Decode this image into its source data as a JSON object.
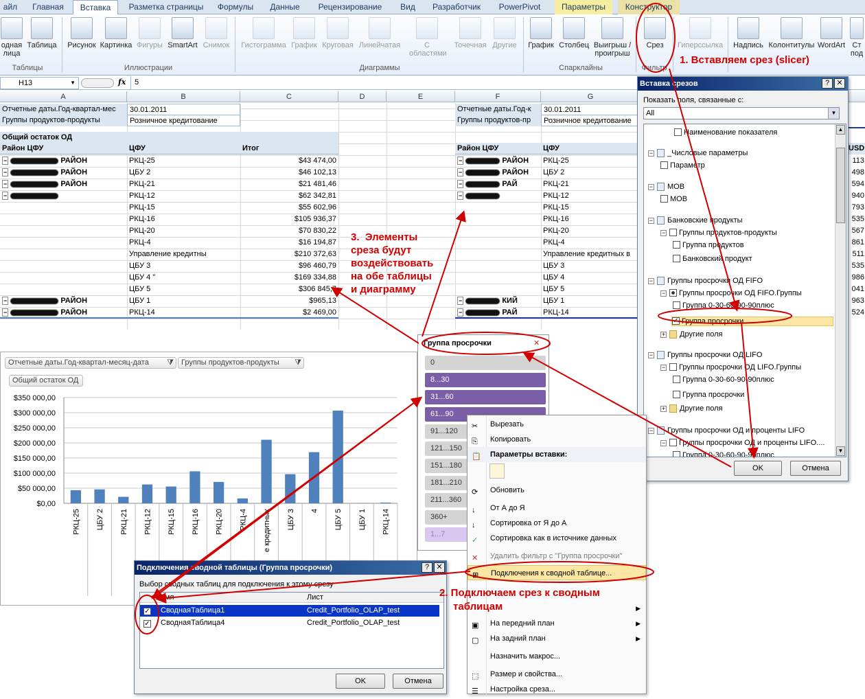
{
  "ribbon": {
    "tabs": [
      "айл",
      "Главная",
      "Вставка",
      "Разметка страницы",
      "Формулы",
      "Данные",
      "Рецензирование",
      "Вид",
      "Разработчик",
      "PowerPivot",
      "Параметры",
      "Конструктор"
    ],
    "buttons": {
      "pivot": "одная\nлица",
      "table": "Таблица",
      "picture": "Рисунок",
      "clipart": "Картинка",
      "shapes": "Фигуры",
      "smartart": "SmartArt",
      "screenshot": "Снимок",
      "hist": "Гистограмма",
      "line": "График",
      "pie": "Круговая",
      "bar": "Линейчатая",
      "area": "С\nобластями",
      "scatter": "Точечная",
      "other": "Другие",
      "sp_line": "График",
      "sp_col": "Столбец",
      "sp_wl": "Выигрыш /\nпроигрыш",
      "slicer": "Срез",
      "hyperlink": "Гиперссылка",
      "textbox": "Надпись",
      "header": "Колонтитулы",
      "wordart": "WordArt",
      "sign": "Ст\nпод"
    },
    "groups": {
      "tables": "Таблицы",
      "illustrations": "Иллюстрации",
      "charts": "Диаграммы",
      "sparklines": "Спарклайны",
      "filter": "Фильтр"
    }
  },
  "formula_bar": {
    "name_box": "H13",
    "fx": "fx",
    "value": "5"
  },
  "columns": [
    "A",
    "B",
    "C",
    "D",
    "E",
    "F",
    "G"
  ],
  "pivot1": {
    "filters": [
      [
        "Отчетные даты.Год-квартал-мес",
        "30.01.2011"
      ],
      [
        "Группы продуктов-продукты",
        "Розничное кредитование"
      ]
    ],
    "measure": "Общий остаток ОД",
    "headers": [
      "Район ЦФУ",
      "ЦФУ",
      "Итог"
    ],
    "rows": [
      [
        "РАЙОН",
        "РКЦ-25",
        "$43 474,00"
      ],
      [
        "РАЙОН",
        "ЦБУ 2",
        "$46 102,13"
      ],
      [
        "РАЙОН",
        "РКЦ-21",
        "$21 481,46"
      ],
      [
        "",
        "РКЦ-12",
        "$62 342,81"
      ],
      [
        "",
        "РКЦ-15",
        "$55 602,96"
      ],
      [
        "",
        "РКЦ-16",
        "$105 936,37"
      ],
      [
        "",
        "РКЦ-20",
        "$70 830,22"
      ],
      [
        "",
        "РКЦ-4",
        "$16 194,87"
      ],
      [
        "",
        "Управление кредитны",
        "$210 372,63"
      ],
      [
        "",
        "ЦБУ 3",
        "$96 460,79"
      ],
      [
        "",
        "ЦБУ 4 \"",
        "$169 334,88"
      ],
      [
        "",
        "ЦБУ 5",
        "$306 845,7"
      ],
      [
        "РАЙОН",
        "ЦБУ 1",
        "$965,13"
      ],
      [
        "РАЙОН",
        "РКЦ-14",
        "$2 469,00"
      ]
    ]
  },
  "pivot2": {
    "filters": [
      [
        "Отчетные даты.Год-к",
        "30.01.2011"
      ],
      [
        "Группы продуктов-пр",
        "Розничное кредитование"
      ]
    ],
    "headers": [
      "Район ЦФУ",
      "ЦФУ"
    ],
    "rows": [
      [
        "РАЙОН",
        "РКЦ-25",
        "113"
      ],
      [
        "РАЙОН",
        "ЦБУ 2",
        "498"
      ],
      [
        "РАЙ",
        "РКЦ-21",
        "594"
      ],
      [
        "",
        "РКЦ-12",
        "940"
      ],
      [
        "",
        "РКЦ-15",
        "793"
      ],
      [
        "",
        "РКЦ-16",
        "535"
      ],
      [
        "",
        "РКЦ-20",
        "567"
      ],
      [
        "",
        "РКЦ-4",
        "861"
      ],
      [
        "",
        "Управление кредитных в",
        "511"
      ],
      [
        "",
        "ЦБУ 3",
        "535"
      ],
      [
        "",
        "ЦБУ 4",
        "986"
      ],
      [
        "",
        "ЦБУ 5",
        "041"
      ],
      [
        "КИЙ",
        "ЦБУ 1",
        "963"
      ],
      [
        "РАЙ",
        "РКЦ-14",
        "524"
      ]
    ],
    "usd": "USD"
  },
  "chart": {
    "filter_buttons": [
      "Отчетные даты.Год-квартал-месяц-дата",
      "Группы продуктов-продукты"
    ],
    "measure_button": "Общий остаток ОД"
  },
  "chart_data": {
    "type": "bar",
    "categories": [
      "РКЦ-25",
      "ЦБУ 2",
      "РКЦ-21",
      "РКЦ-12",
      "РКЦ-15",
      "РКЦ-16",
      "РКЦ-20",
      "РКЦ-4",
      "е кредитных",
      "ЦБУ 3",
      "4",
      "ЦБУ 5",
      "ЦБУ 1",
      "РКЦ-14"
    ],
    "values": [
      43474,
      46102,
      21481,
      62343,
      55603,
      105936,
      70830,
      16195,
      210373,
      96461,
      169335,
      306846,
      965,
      2469
    ],
    "ylim": [
      0,
      350000
    ],
    "yticks": [
      "$350 000,00",
      "$300 000,00",
      "$250 000,00",
      "$200 000,00",
      "$150 000,00",
      "$100 000,00",
      "$50 000,00",
      "$0,00"
    ],
    "title": "",
    "xlabel": "",
    "ylabel": "",
    "color": "#4f81bd"
  },
  "slicer": {
    "title": "Группа просрочки",
    "items": [
      [
        "0",
        "off"
      ],
      [
        "8...30",
        "on"
      ],
      [
        "31...60",
        "on"
      ],
      [
        "61...90",
        "on"
      ],
      [
        "91...120",
        "off"
      ],
      [
        "121...150",
        "off"
      ],
      [
        "151...180",
        "off"
      ],
      [
        "181...210",
        "off"
      ],
      [
        "211...360",
        "off"
      ],
      [
        "360+",
        "off"
      ],
      [
        "1...7",
        "ghost"
      ]
    ]
  },
  "insert_slicers": {
    "title": "Вставка срезов",
    "show_label": "Показать поля, связанные с:",
    "show_value": "All",
    "tree": [
      [
        0,
        "",
        "cb",
        "Наименование показателя"
      ],
      [
        0,
        "−",
        "tb",
        "_Числовые параметры"
      ],
      [
        1,
        "",
        "cb",
        "Параметр"
      ],
      [
        0,
        "−",
        "tb",
        "МОВ"
      ],
      [
        1,
        "",
        "cb",
        "МОВ"
      ],
      [
        0,
        "−",
        "tb",
        "Банковские продукты"
      ],
      [
        1,
        "−",
        "cb",
        "Группы продуктов-продукты"
      ],
      [
        2,
        "",
        "cb",
        "Группа продуктов"
      ],
      [
        2,
        "",
        "cb",
        "Банковский продукт"
      ],
      [
        0,
        "−",
        "tb",
        "Группы просрочки ОД FIFO"
      ],
      [
        1,
        "−",
        "cbp",
        "Группы просрочки ОД FIFO.Группы"
      ],
      [
        2,
        "",
        "cb",
        "Группа 0-30-60-90-90плюс"
      ],
      [
        2,
        "",
        "cbx",
        "Группа просрочки"
      ],
      [
        1,
        "+",
        "fd",
        "Другие поля"
      ],
      [
        0,
        "−",
        "tb",
        "Группы просрочки ОД LIFO"
      ],
      [
        1,
        "−",
        "cb",
        "Группы просрочки ОД LIFO.Группы"
      ],
      [
        2,
        "",
        "cb",
        "Группа 0-30-60-90-90плюс"
      ],
      [
        2,
        "",
        "cb",
        "Группа просрочки"
      ],
      [
        1,
        "+",
        "fd",
        "Другие поля"
      ],
      [
        0,
        "−",
        "tb",
        "Группы просрочки ОД и проценты LIFO"
      ],
      [
        1,
        "−",
        "cb",
        "Группы просрочки ОД и проценты LIFO...."
      ],
      [
        2,
        "",
        "cb",
        "Группа 0-30-60-90-90плюс"
      ]
    ],
    "ok": "OK",
    "cancel": "Отмена"
  },
  "context_menu": {
    "items": [
      "Вырезать",
      "Копировать",
      "Параметры вставки:",
      "Обновить",
      "От А до Я",
      "Сортировка от Я до А",
      "Сортировка как в источнике данных",
      "Удалить фильтр с \"Группа просрочки\"",
      "Подключения к сводной таблице...",
      "",
      "На передний план",
      "На задний план",
      "Назначить макрос...",
      "Размер и свойства...",
      "Настройка среза..."
    ]
  },
  "connections": {
    "title": "Подключения сводной таблицы (Группа просрочки)",
    "subtitle": "Выбор сводных таблиц для подключения к этому срезу",
    "col_name": "Имя",
    "col_sheet": "Лист",
    "rows": [
      [
        "СводнаяТаблица1",
        "Credit_Portfolio_OLAP_test"
      ],
      [
        "СводнаяТаблица4",
        "Credit_Portfolio_OLAP_test"
      ]
    ],
    "ok": "OK",
    "cancel": "Отмена"
  },
  "annotations": {
    "step1": "1. Вставляем срез (slicer)",
    "step2a": "2. Подключаем срез к сводным",
    "step2b": "таблицам",
    "step3": "3.  Элементы\nсреза будут\nвоздействовать\nна обе таблицы\nи диаграмму"
  }
}
